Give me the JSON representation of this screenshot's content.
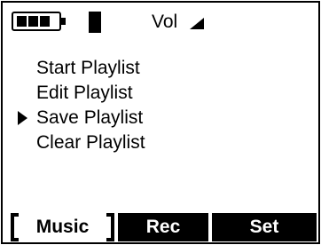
{
  "status_bar": {
    "battery_level": 3,
    "battery_capacity": 3,
    "volume_label": "Vol",
    "icons": [
      "battery-icon",
      "signal-icon",
      "volume-icon"
    ]
  },
  "menu": {
    "items": [
      {
        "label": "Start Playlist"
      },
      {
        "label": "Edit Playlist"
      },
      {
        "label": "Save Playlist"
      },
      {
        "label": "Clear Playlist"
      }
    ],
    "selected_index": 2
  },
  "softkeys": {
    "music": "Music",
    "rec": "Rec",
    "set": "Set",
    "active": "Music"
  },
  "colors": {
    "background": "#ffffff",
    "foreground": "#000000"
  }
}
